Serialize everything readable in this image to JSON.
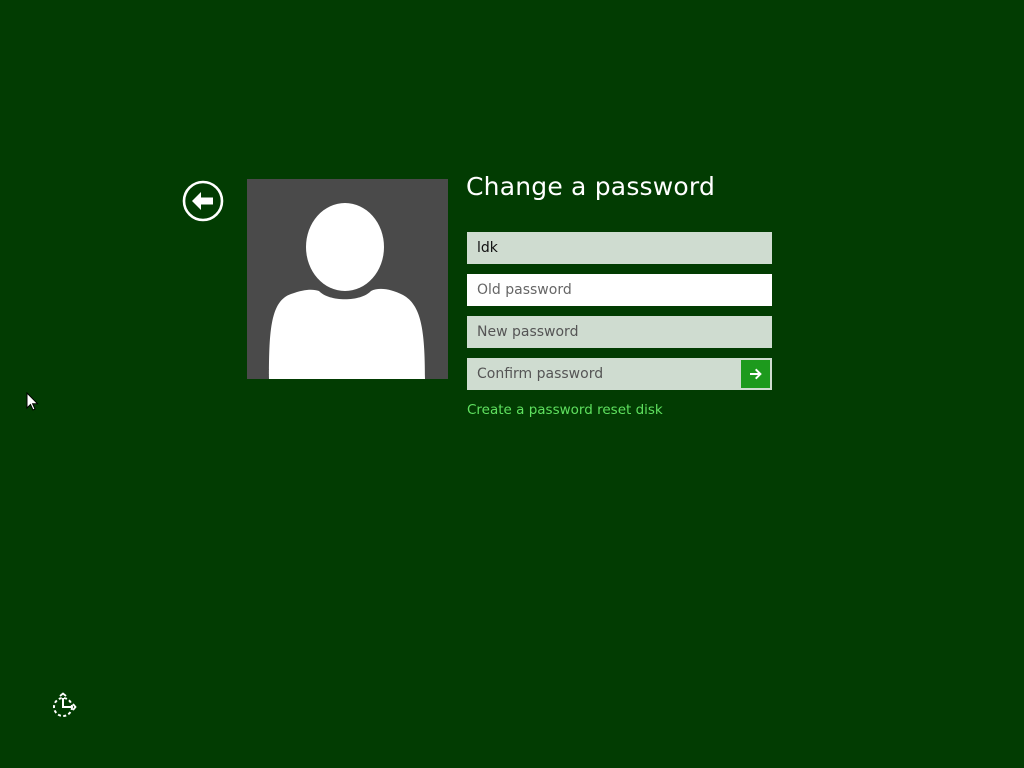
{
  "screen": {
    "title": "Change a password",
    "background_color": "#023c02",
    "accent_color": "#1d9a1d",
    "link_color": "#5fe05f"
  },
  "back": {
    "icon": "back-arrow-circle-icon"
  },
  "user_tile": {
    "icon": "user-silhouette-icon"
  },
  "form": {
    "username_value": "ldk",
    "old_password_placeholder": "Old password",
    "new_password_placeholder": "New password",
    "confirm_password_placeholder": "Confirm password",
    "submit_icon": "arrow-right-icon",
    "reset_disk_link": "Create a password reset disk"
  },
  "system": {
    "ease_of_access_icon": "ease-of-access-icon",
    "cursor_icon": "mouse-pointer-icon"
  }
}
